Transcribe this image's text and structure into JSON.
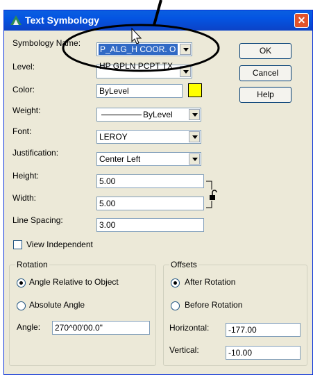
{
  "window": {
    "title": "Text Symbology",
    "close_glyph": "✕"
  },
  "fields": {
    "symbology_name": {
      "label": "Symbology Name:",
      "value": "P_ALG_H COOR. O"
    },
    "level": {
      "label": "Level:",
      "value": "HP GPLN PCPT TX"
    },
    "color": {
      "label": "Color:",
      "value": "ByLevel",
      "swatch": "#ffff00"
    },
    "weight": {
      "label": "Weight:",
      "value": "ByLevel"
    },
    "font": {
      "label": "Font:",
      "value": "LEROY"
    },
    "justification": {
      "label": "Justification:",
      "value": "Center Left"
    },
    "height": {
      "label": "Height:",
      "value": "5.00"
    },
    "width": {
      "label": "Width:",
      "value": "5.00"
    },
    "line_spacing": {
      "label": "Line Spacing:",
      "value": "3.00"
    }
  },
  "view_independent": {
    "label": "View Independent",
    "checked": false
  },
  "buttons": {
    "ok": "OK",
    "cancel": "Cancel",
    "help": "Help"
  },
  "rotation": {
    "title": "Rotation",
    "opt_relative": "Angle Relative to Object",
    "opt_absolute": "Absolute Angle",
    "angle_label": "Angle:",
    "angle_value": "270^00'00.0\"",
    "selected": "relative"
  },
  "offsets": {
    "title": "Offsets",
    "opt_after": "After Rotation",
    "opt_before": "Before Rotation",
    "horizontal_label": "Horizontal:",
    "horizontal_value": "-177.00",
    "vertical_label": "Vertical:",
    "vertical_value": "-10.00",
    "selected": "after"
  },
  "icons": [
    "app-icon",
    "close-icon",
    "chevron-down-icon",
    "lock-icon",
    "mouse-cursor-icon"
  ],
  "colors": {
    "title_bar": "#0454e2",
    "dialog_bg": "#ece9d8",
    "selection": "#316ac5",
    "close": "#e2532b"
  }
}
